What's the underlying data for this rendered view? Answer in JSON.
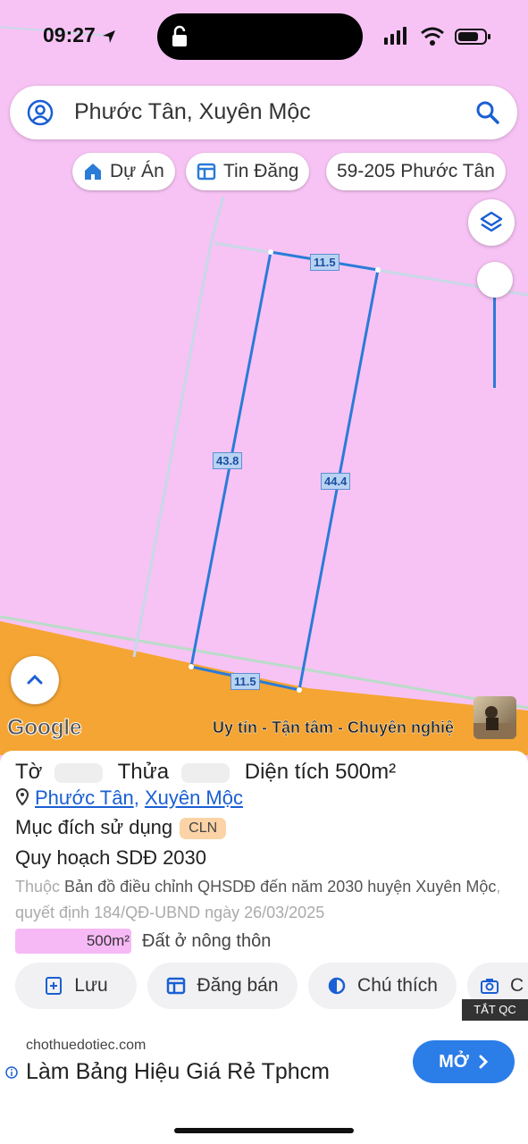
{
  "status_bar": {
    "time": "09:27",
    "icons": [
      "location-arrow-icon",
      "lock-icon",
      "signal-icon",
      "wifi-icon",
      "battery-icon"
    ]
  },
  "search": {
    "query": "Phước Tân, Xuyên Mộc",
    "icons": [
      "user-circle-icon",
      "search-icon"
    ]
  },
  "chips": [
    {
      "label": "Dự Án",
      "icon": "home-icon"
    },
    {
      "label": "Tin Đăng",
      "icon": "listing-icon"
    },
    {
      "label": "59-205 Phước Tân",
      "icon": ""
    }
  ],
  "map": {
    "dimensions": {
      "top": "11.5",
      "left": "43.8",
      "right": "44.4",
      "bottom": "11.5"
    },
    "google_logo": "Google",
    "watermark": "Uy tín - Tận tâm - Chuyên nghiệ",
    "colors": {
      "land_pink": "#f7c3f4",
      "road_orange": "#f5a533",
      "parcel_line": "#2b7bd8"
    }
  },
  "panel": {
    "to_label": "Tờ",
    "thua_label": "Thửa",
    "area_text": "Diện tích 500m²",
    "location_ward": "Phước Tân",
    "location_sep": ",",
    "location_district": "Xuyên Mộc",
    "purpose_label": "Mục đích sử dụng",
    "purpose_badge": "CLN",
    "plan_title": "Quy hoạch SDĐ 2030",
    "desc_prefix": "Thuộc",
    "desc_main": "Bản đồ điều chỉnh QHSDĐ đến năm 2030 huyện Xuyên Mộc",
    "desc_suffix": ", quyết định 184/QĐ-UBND ngày 26/03/2025",
    "legend_area": "500m²",
    "legend_label": "Đất ở nông thôn"
  },
  "actions": [
    {
      "label": "Lưu",
      "icon": "bookmark-plus-icon"
    },
    {
      "label": "Đăng bán",
      "icon": "listing-icon"
    },
    {
      "label": "Chú thích",
      "icon": "half-circle-icon"
    },
    {
      "label": "C",
      "icon": "camera-icon"
    }
  ],
  "ad": {
    "tag": "TẮT QC",
    "domain": "chothuedotiec.com",
    "title": "Làm Bảng Hiệu Giá Rẻ Tphcm",
    "button": "MỞ"
  }
}
